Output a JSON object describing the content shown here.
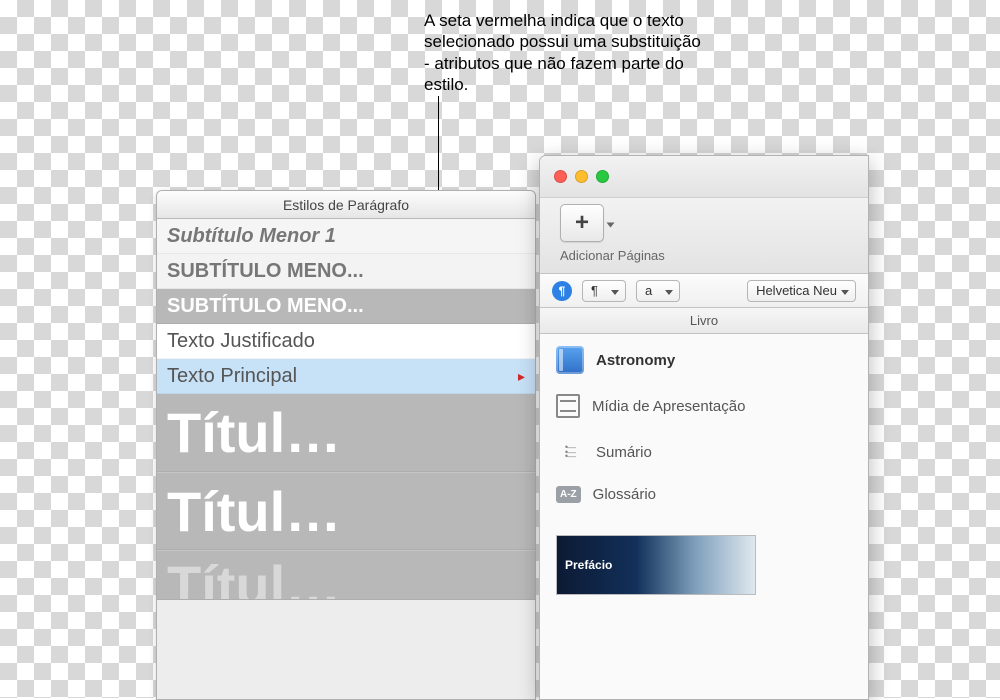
{
  "callout": {
    "text": "A seta vermelha indica que o texto selecionado possui uma substituição - atributos que não fazem parte do estilo."
  },
  "styles_panel": {
    "title": "Estilos de Parágrafo",
    "items": {
      "s0": "Subtítulo Menor 1",
      "s1": "SUBTÍTULO MENO...",
      "s2": "SUBTÍTULO MENO...",
      "s3": "Texto Justificado",
      "s4": "Texto Principal",
      "s5": "Títul…",
      "s6": "Títul…",
      "s7": "Títul…"
    }
  },
  "main_window": {
    "add_pages_label": "Adicionar Páginas",
    "pilcrow": "¶",
    "combo_pilcrow": "¶",
    "combo_a": "a",
    "font_name": "Helvetica Neu",
    "section_label": "Livro",
    "menu": {
      "book": "Astronomy",
      "media": "Mídia de Apresentação",
      "toc": "Sumário",
      "glossary": "Glossário"
    },
    "thumb_label": "Prefácio"
  }
}
